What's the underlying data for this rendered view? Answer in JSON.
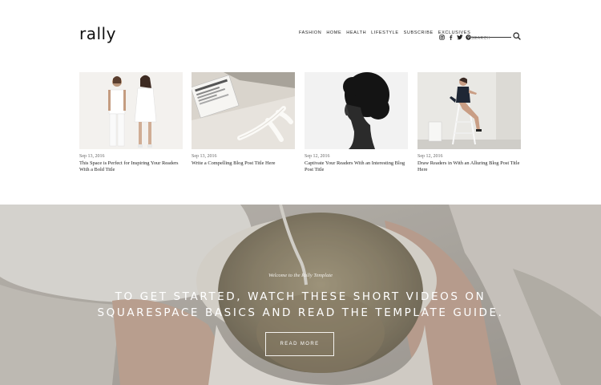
{
  "brand": {
    "logo": "rally"
  },
  "nav": {
    "items": [
      "FASHION",
      "HOME",
      "HEALTH",
      "LIFESTYLE",
      "SUBSCRIBE",
      "EXCLUSIVES"
    ]
  },
  "social": {
    "icons": [
      "instagram-icon",
      "facebook-icon",
      "twitter-icon",
      "pinterest-icon"
    ]
  },
  "search": {
    "placeholder": "SEARCH"
  },
  "posts": [
    {
      "date": "Sep 13, 2016",
      "title": "This Space is Perfect for Inspiring Your Readers With a Bold Title"
    },
    {
      "date": "Sep 13, 2016",
      "title": "Write a Compelling Blog Post Title Here"
    },
    {
      "date": "Sep 12, 2016",
      "title": "Captivate Your Readers With an Interesting Blog Post Title"
    },
    {
      "date": "Sep 12, 2016",
      "title": "Draw Readers in With an Alluring Blog Post Title Here"
    }
  ],
  "hero": {
    "kicker": "Welcome to the Rally Template",
    "headline": "TO GET STARTED, WATCH THESE SHORT VIDEOS ON SQUARESPACE BASICS AND READ THE TEMPLATE GUIDE.",
    "button_label": "READ MORE"
  },
  "colors": {
    "text": "#222222",
    "hero_overlay": "#8c8577",
    "background": "#ffffff"
  }
}
